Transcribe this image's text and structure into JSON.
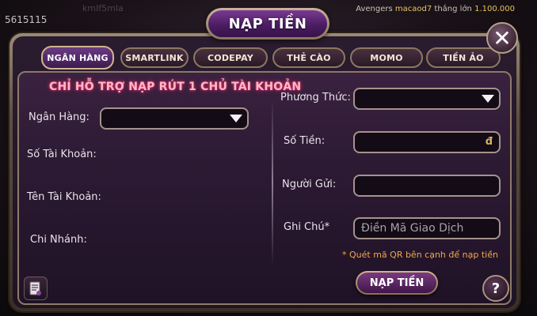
{
  "background": {
    "left_number": "5615115",
    "faint_text": "kmIf5mla",
    "leader_group": "Avengers",
    "leader_user": "macaod7",
    "leader_label": "thắng lớn",
    "leader_amount": "1.100.000"
  },
  "dialog": {
    "title": "NẠP TIỀN",
    "close_label": "✕",
    "tabs": [
      {
        "label": "NGÂN HÀNG",
        "active": true
      },
      {
        "label": "SMARTLINK",
        "active": false
      },
      {
        "label": "CODEPAY",
        "active": false
      },
      {
        "label": "THẺ CÀO",
        "active": false
      },
      {
        "label": "MOMO",
        "active": false
      },
      {
        "label": "TIỀN ẢO",
        "active": false
      }
    ],
    "notice": "CHỈ HỖ TRỢ NẠP RÚT 1 CHỦ TÀI KHOẢN",
    "left": {
      "bank_label": "Ngân Hàng:",
      "bank_value": "",
      "account_number_label": "Số Tài Khoản:",
      "account_name_label": "Tên Tài Khoản:",
      "branch_label": "Chi Nhánh:"
    },
    "right": {
      "method_label": "Phương Thức:",
      "method_value": "",
      "amount_label": "Số Tiền:",
      "amount_unit": "đ",
      "sender_label": "Người Gửi:",
      "note_label": "Ghi Chú*",
      "note_placeholder": "Điền Mã Giao Dịch"
    },
    "qr_hint": "* Quét mã QR bên cạnh để nạp tiền",
    "submit_label": "NẠP TIỀN",
    "help_label": "?"
  },
  "colors": {
    "notice_glow": "#e0246a",
    "hint": "#f0a848",
    "accent_gold": "#d2b48e",
    "panel": "#2c1a33"
  }
}
